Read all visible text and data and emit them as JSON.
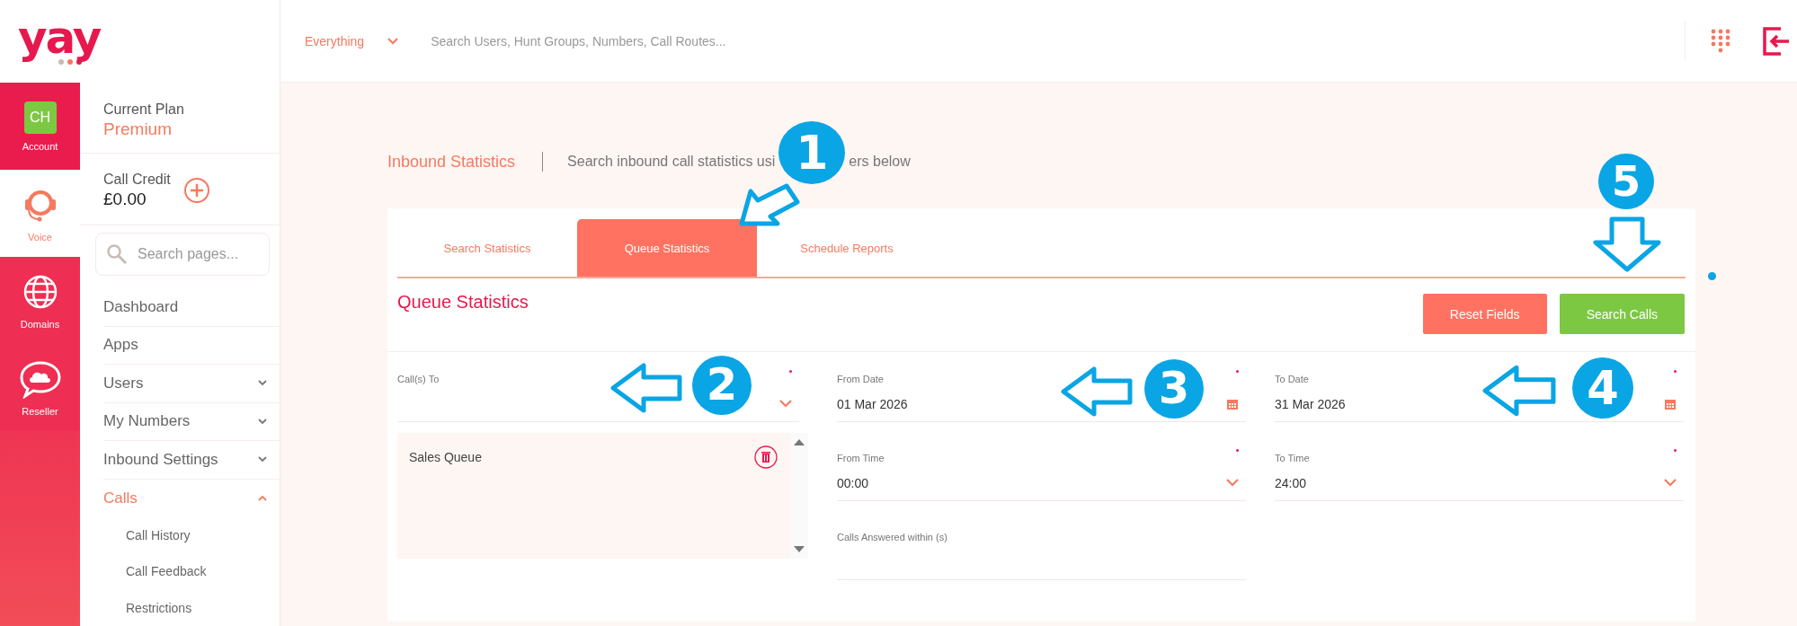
{
  "logo": {
    "text": "yay"
  },
  "topbar": {
    "scope": "Everything",
    "search_placeholder": "Search Users, Hunt Groups, Numbers, Call Routes..."
  },
  "rail": [
    {
      "label": "Account",
      "kind": "avatar",
      "initials": "CH",
      "selected": false
    },
    {
      "label": "Voice",
      "kind": "headset",
      "selected": true
    },
    {
      "label": "Domains",
      "kind": "globe",
      "selected": false
    },
    {
      "label": "Reseller",
      "kind": "cloud",
      "selected": false
    }
  ],
  "sidebar": {
    "plan_label": "Current Plan",
    "plan": "Premium",
    "credit_label": "Call Credit",
    "credit": "£0.00",
    "search_placeholder": "Search pages...",
    "items": [
      {
        "label": "Dashboard",
        "kind": "link"
      },
      {
        "label": "Apps",
        "kind": "link"
      },
      {
        "label": "Users",
        "kind": "group",
        "expanded": false
      },
      {
        "label": "My Numbers",
        "kind": "group",
        "expanded": false
      },
      {
        "label": "Inbound Settings",
        "kind": "group",
        "expanded": false
      },
      {
        "label": "Calls",
        "kind": "group",
        "expanded": true,
        "children": [
          {
            "label": "Call History"
          },
          {
            "label": "Call Feedback"
          },
          {
            "label": "Restrictions"
          }
        ]
      }
    ]
  },
  "page": {
    "title": "Inbound Statistics",
    "subtitle_parts": [
      "Search inbound call statistics usi",
      "ers below"
    ]
  },
  "tabs": [
    {
      "label": "Search Statistics",
      "selected": false
    },
    {
      "label": "Queue Statistics",
      "selected": true
    },
    {
      "label": "Schedule Reports",
      "selected": false
    }
  ],
  "section_title": "Queue Statistics",
  "buttons": [
    {
      "label": "Reset Fields",
      "kind": "reset"
    },
    {
      "label": "Search Calls",
      "kind": "search"
    }
  ],
  "columns": [
    {
      "fields": [
        {
          "label": "Call(s) To",
          "kind": "select",
          "required": true,
          "list": [
            "Sales Queue"
          ]
        }
      ]
    },
    {
      "fields": [
        {
          "label": "From Date",
          "kind": "date",
          "required": true,
          "value": "01 Mar 2026"
        },
        {
          "label": "From Time",
          "kind": "select",
          "required": true,
          "value": "00:00"
        },
        {
          "label": "Calls Answered within (s)",
          "kind": "text",
          "required": false
        }
      ]
    },
    {
      "fields": [
        {
          "label": "To Date",
          "kind": "date",
          "required": true,
          "value": "31 Mar 2026"
        },
        {
          "label": "To Time",
          "kind": "select",
          "required": true,
          "value": "24:00"
        }
      ]
    }
  ],
  "annotations": [
    {
      "number": "1",
      "kind": "down-left"
    },
    {
      "number": "2",
      "kind": "left"
    },
    {
      "number": "3",
      "kind": "left"
    },
    {
      "number": "4",
      "kind": "left"
    },
    {
      "number": "5",
      "kind": "down"
    }
  ]
}
